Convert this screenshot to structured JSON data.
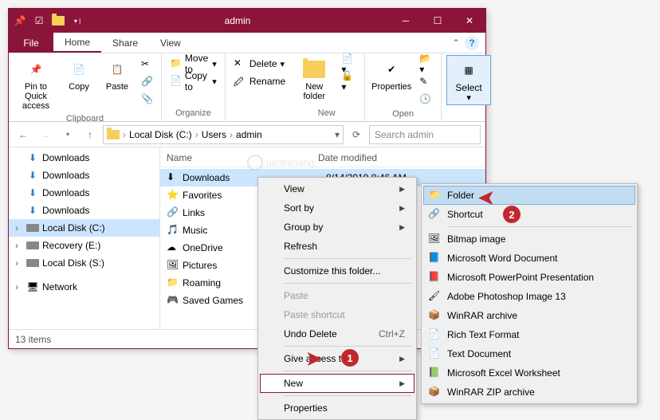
{
  "titlebar": {
    "title": "admin"
  },
  "tabs": {
    "file": "File",
    "home": "Home",
    "share": "Share",
    "view": "View"
  },
  "ribbon": {
    "pin": "Pin to Quick access",
    "copy": "Copy",
    "paste": "Paste",
    "moveto": "Move to",
    "copyto": "Copy to",
    "delete": "Delete",
    "rename": "Rename",
    "newfolder": "New folder",
    "properties": "Properties",
    "select": "Select",
    "groups": {
      "clipboard": "Clipboard",
      "organize": "Organize",
      "new": "New",
      "open": "Open"
    }
  },
  "breadcrumb": [
    "Local Disk (C:)",
    "Users",
    "admin"
  ],
  "search_placeholder": "Search admin",
  "sidebar": {
    "items": [
      {
        "label": "Downloads"
      },
      {
        "label": "Downloads"
      },
      {
        "label": "Downloads"
      },
      {
        "label": "Downloads"
      },
      {
        "label": "Local Disk (C:)",
        "selected": true
      },
      {
        "label": "Recovery (E:)"
      },
      {
        "label": "Local Disk (S:)"
      }
    ],
    "network": "Network"
  },
  "columns": {
    "name": "Name",
    "modified": "Date modified"
  },
  "files": [
    {
      "label": "Downloads",
      "modified": "8/14/2019 8:46 AM",
      "selected": true,
      "icon": "download"
    },
    {
      "label": "Favorites",
      "icon": "star"
    },
    {
      "label": "Links",
      "icon": "link"
    },
    {
      "label": "Music",
      "icon": "music"
    },
    {
      "label": "OneDrive",
      "icon": "cloud"
    },
    {
      "label": "Pictures",
      "icon": "pictures"
    },
    {
      "label": "Roaming",
      "icon": "folder"
    },
    {
      "label": "Saved Games",
      "icon": "games"
    }
  ],
  "status": "13 items",
  "context1": {
    "view": "View",
    "sortby": "Sort by",
    "groupby": "Group by",
    "refresh": "Refresh",
    "customize": "Customize this folder...",
    "paste": "Paste",
    "paste_shortcut": "Paste shortcut",
    "undo": "Undo Delete",
    "undo_key": "Ctrl+Z",
    "give_access": "Give access to",
    "new": "New",
    "properties": "Properties"
  },
  "context2": [
    {
      "label": "Folder",
      "icon": "folder",
      "hover": true
    },
    {
      "label": "Shortcut",
      "icon": "shortcut"
    },
    {
      "label": "Bitmap image",
      "icon": "bmp",
      "sep_before": true
    },
    {
      "label": "Microsoft Word Document",
      "icon": "word"
    },
    {
      "label": "Microsoft PowerPoint Presentation",
      "icon": "ppt"
    },
    {
      "label": "Adobe Photoshop Image 13",
      "icon": "psd"
    },
    {
      "label": "WinRAR archive",
      "icon": "rar"
    },
    {
      "label": "Rich Text Format",
      "icon": "rtf"
    },
    {
      "label": "Text Document",
      "icon": "txt"
    },
    {
      "label": "Microsoft Excel Worksheet",
      "icon": "xlsx"
    },
    {
      "label": "WinRAR ZIP archive",
      "icon": "zip"
    }
  ],
  "watermark": "uantrimang"
}
